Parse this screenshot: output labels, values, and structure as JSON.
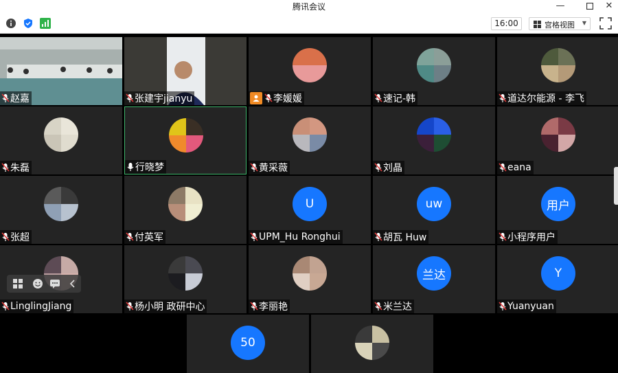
{
  "window": {
    "title": "腾讯会议"
  },
  "toolbar": {
    "time": "16:00",
    "view_label": "宫格视图",
    "colors": {
      "shield": "#1677ff",
      "signal": "#2fb34a"
    }
  },
  "grid": {
    "row1": [
      {
        "name": "赵嘉",
        "type": "video-room"
      },
      {
        "name": "张建宇jianyu",
        "type": "video-person"
      },
      {
        "name": "李媛媛",
        "type": "avatar",
        "host": true,
        "colors": [
          "#d9704a",
          "#d9704a",
          "#e89a9a",
          "#e89a9a"
        ]
      },
      {
        "name": "速记-韩",
        "type": "avatar",
        "colors": [
          "#7fa39a",
          "#8b9e98",
          "#4f8a86",
          "#6d7f86"
        ]
      },
      {
        "name": "道达尔能源 - 李飞",
        "type": "avatar",
        "colors": [
          "#4e5a3c",
          "#6b7156",
          "#c8b38c",
          "#b49a78"
        ]
      }
    ],
    "row2": [
      {
        "name": "朱磊",
        "type": "avatar",
        "colors": [
          "#d8d4c6",
          "#e9e5d9",
          "#cac5b7",
          "#e0dccf"
        ]
      },
      {
        "name": "行晓梦",
        "type": "avatar",
        "active": true,
        "colors": [
          "#e0c419",
          "#3a2f25",
          "#f08a2c",
          "#e3597c"
        ]
      },
      {
        "name": "黄采薇",
        "type": "avatar",
        "colors": [
          "#c98f77",
          "#d39781",
          "#b9b8bd",
          "#7a8ba6"
        ]
      },
      {
        "name": "刘晶",
        "type": "avatar",
        "colors": [
          "#1546c9",
          "#2a5fe6",
          "#3b1f3a",
          "#1e4d33"
        ]
      },
      {
        "name": "eana",
        "type": "avatar",
        "colors": [
          "#b06a6a",
          "#7a3a45",
          "#4a2230",
          "#d3a7a7"
        ]
      }
    ],
    "row3": [
      {
        "name": "张超",
        "type": "avatar",
        "colors": [
          "#5a5a5a",
          "#3a3a3a",
          "#8fa0b5",
          "#b7c2cf"
        ]
      },
      {
        "name": "付英军",
        "type": "avatar",
        "colors": [
          "#8d7a66",
          "#e8e2c4",
          "#b88e79",
          "#f0eed2"
        ]
      },
      {
        "name": "UPM_Hu Ronghui",
        "type": "initial",
        "initial": "U"
      },
      {
        "name": "胡瓦 Huw",
        "type": "initial",
        "initial": "uw"
      },
      {
        "name": "小程序用户",
        "type": "initial",
        "initial": "用户"
      }
    ],
    "row4": [
      {
        "name": "LinglingJiang",
        "type": "avatar",
        "colors": [
          "#5d4b55",
          "#c6aaa6",
          "#b89c9e",
          "#d6b2ad"
        ]
      },
      {
        "name": "杨小明 政研中心",
        "type": "avatar",
        "colors": [
          "#3a3a3a",
          "#4a4a52",
          "#1c1c20",
          "#c8ccd6"
        ]
      },
      {
        "name": "李丽艳",
        "type": "avatar",
        "colors": [
          "#a98874",
          "#c2a391",
          "#e0cfc3",
          "#c8a894"
        ]
      },
      {
        "name": "米兰达",
        "type": "initial",
        "initial": "兰达"
      },
      {
        "name": "Yuanyuan",
        "type": "initial",
        "initial": "Y"
      }
    ],
    "row5": [
      {
        "name": "",
        "type": "initial",
        "initial": "50"
      },
      {
        "name": "",
        "type": "avatar",
        "colors": [
          "#3a3a3a",
          "#c8c0a2",
          "#d9d3b9",
          "#4a4a4a"
        ]
      }
    ]
  }
}
